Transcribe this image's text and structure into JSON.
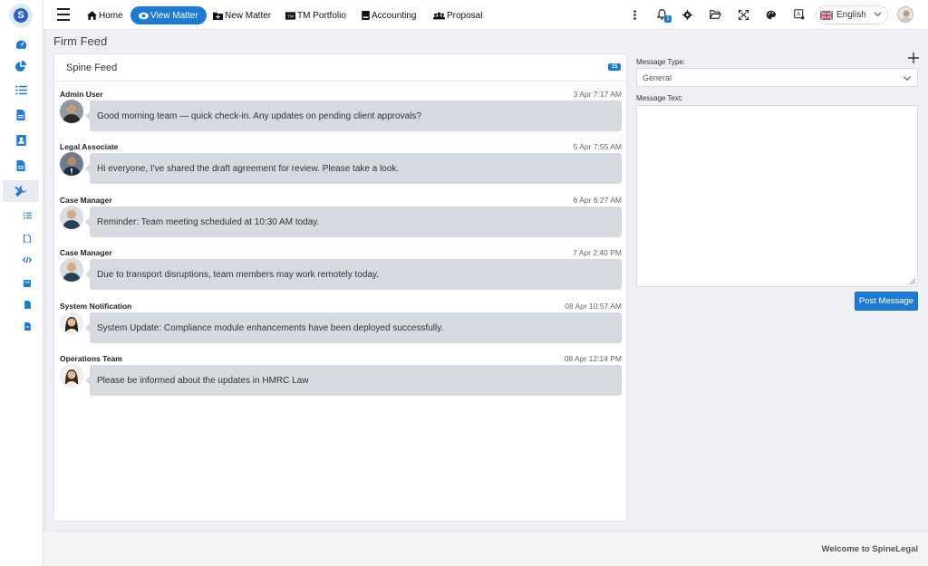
{
  "colors": {
    "accent": "#1f7ad1",
    "bubble": "#d5d9e0"
  },
  "nav": {
    "home": "Home",
    "view_matter": "View Matter",
    "new_matter": "New Matter",
    "tm_portfolio": "TM Portfolio",
    "accounting": "Accounting",
    "proposal": "Proposal",
    "notification_count": "1"
  },
  "language": {
    "selected": "English"
  },
  "page": {
    "title": "Firm Feed"
  },
  "feed": {
    "title": "Spine Feed",
    "count": "15",
    "messages": [
      {
        "author": "Admin User",
        "time": "3 Apr 7:17 AM",
        "text": "Good morning team — quick check-in. Any updates on pending client approvals?"
      },
      {
        "author": "Legal Associate",
        "time": "5 Apr 7:55 AM",
        "text": "Hi everyone, I've shared the draft agreement for review. Please take a look."
      },
      {
        "author": "Case Manager",
        "time": "6 Apr 6:27 AM",
        "text": "Reminder: Team meeting scheduled at 10:30 AM today."
      },
      {
        "author": "Case Manager",
        "time": "7 Apr 2:40 PM",
        "text": "Due to transport disruptions, team members may work remotely today."
      },
      {
        "author": "System Notification",
        "time": "08 Apr 10:57 AM",
        "text": "System Update: Compliance module enhancements have been deployed successfully."
      },
      {
        "author": "Operations Team",
        "time": "08 Apr 12:14 PM",
        "text": "Please be informed about the updates in HMRC Law"
      }
    ]
  },
  "form": {
    "message_type_label": "Message Type:",
    "message_type_value": "General",
    "message_text_label": "Message Text:",
    "message_text_value": "",
    "post_button": "Post Message"
  },
  "footer": {
    "text": "Welcome to SpineLegal"
  }
}
